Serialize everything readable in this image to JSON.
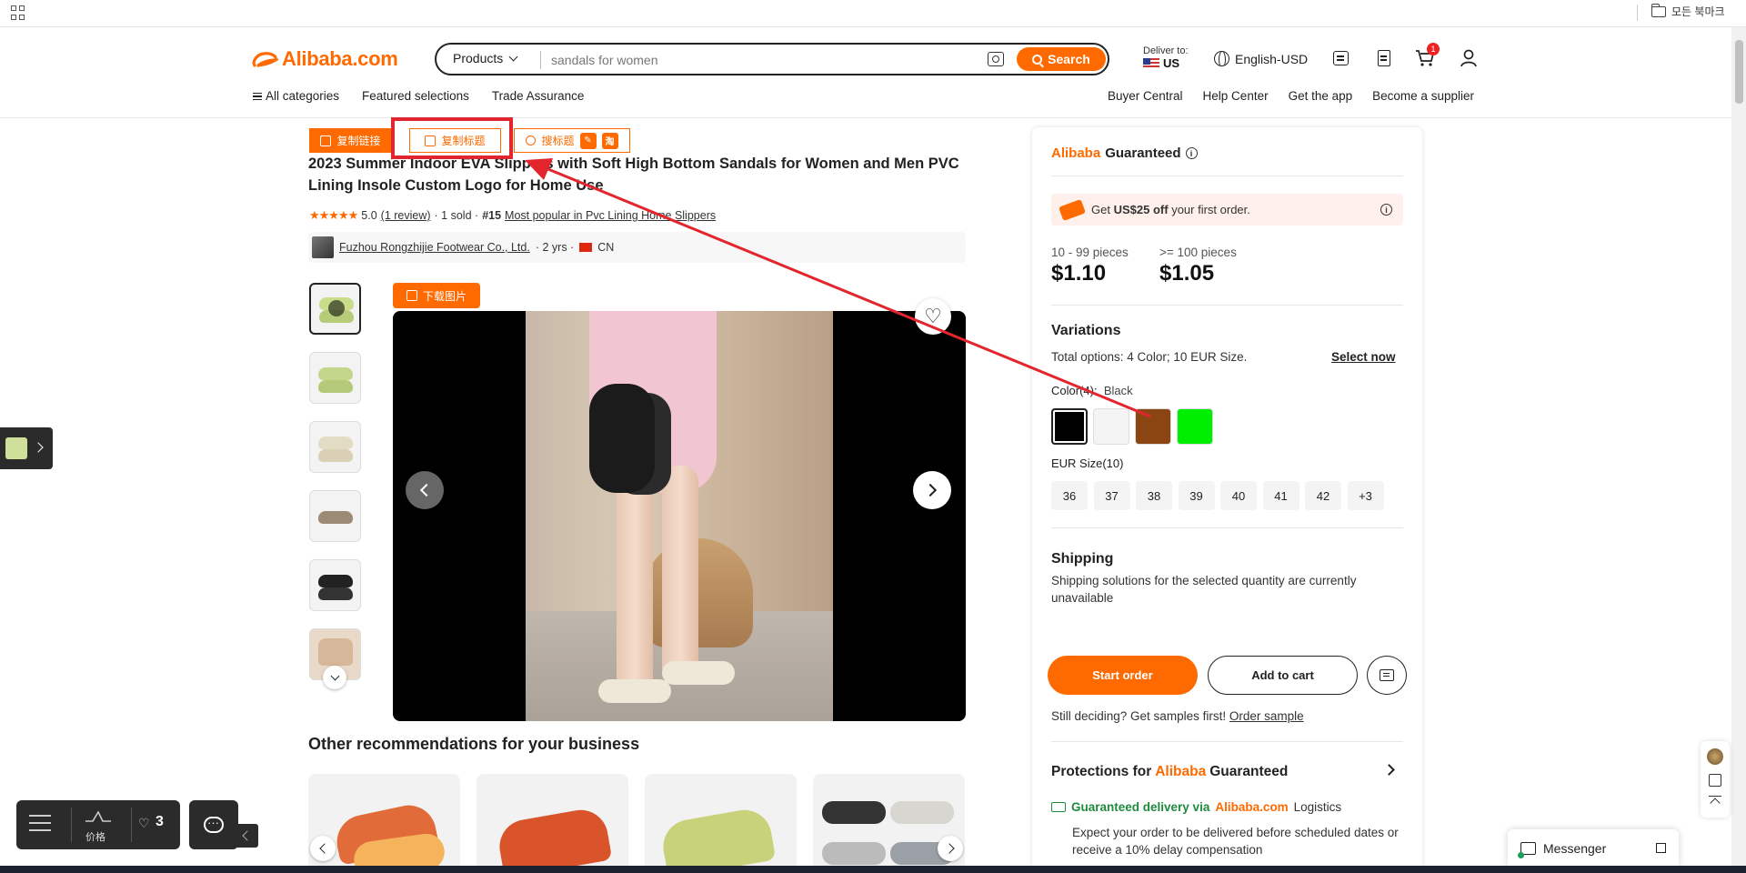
{
  "bookmark_bar": {
    "all_bookmarks": "모든 북마크"
  },
  "header": {
    "logo": "Alibaba.com",
    "search_category": "Products",
    "search_value": "sandals for women",
    "search_button": "Search",
    "deliver_label": "Deliver to:",
    "deliver_country": "US",
    "language": "English-USD",
    "cart_count": "1"
  },
  "nav": {
    "left": [
      "All categories",
      "Featured selections",
      "Trade Assurance"
    ],
    "right": [
      "Buyer Central",
      "Help Center",
      "Get the app",
      "Become a supplier"
    ]
  },
  "toolbar": {
    "copy_link": "复制链接",
    "copy_title": "复制标题",
    "search_title": "搜标题",
    "search_title_badge": "淘"
  },
  "product": {
    "title": "2023 Summer Indoor EVA Slippers with Soft High Bottom Sandals for Women and Men PVC Lining Insole Custom Logo for Home Use",
    "stars": "★★★★★",
    "rating": "5.0",
    "reviews": "(1 review)",
    "sold": "· 1 sold ·",
    "rank": "#15",
    "rank_text": "Most popular in Pvc Lining Home Slippers",
    "supplier": "Fuzhou Rongzhijie Footwear Co., Ltd.",
    "years": "· 2 yrs ·",
    "country": "CN",
    "download_image": "下载图片"
  },
  "recommendations": {
    "title": "Other recommendations for your business"
  },
  "panel": {
    "guaranteed_brand": "Alibaba",
    "guaranteed_word": "Guaranteed",
    "coupon_pre": "Get",
    "coupon_amount": "US$25 off",
    "coupon_post": "your first order.",
    "prices": [
      {
        "qty": "10 - 99 pieces",
        "price": "$1.10"
      },
      {
        "qty": ">= 100 pieces",
        "price": "$1.05"
      }
    ],
    "variations_title": "Variations",
    "variations_sub": "Total options: 4 Color; 10 EUR Size.",
    "select_now": "Select now",
    "color_label": "Color(4):",
    "color_selected": "Black",
    "colors": [
      "#000000",
      "#f4f4f4",
      "#8b4513",
      "#00ee00"
    ],
    "size_label": "EUR Size(10)",
    "sizes": [
      "36",
      "37",
      "38",
      "39",
      "40",
      "41",
      "42",
      "+3"
    ],
    "shipping_title": "Shipping",
    "shipping_text": "Shipping solutions for the selected quantity are currently unavailable",
    "start_order": "Start order",
    "add_to_cart": "Add to cart",
    "samples_text": "Still deciding? Get samples first!",
    "order_sample": "Order sample",
    "protections_pre": "Protections for",
    "protections_brand": "Alibaba",
    "protections_word": "Guaranteed",
    "gd_pre": "Guaranteed delivery via",
    "gd_brand": "Alibaba.com",
    "gd_post": "Logistics",
    "gd_text": "Expect your order to be delivered before scheduled dates or receive a 10% delay compensation"
  },
  "floating": {
    "price_label": "价格",
    "fav_count": "3",
    "messenger": "Messenger"
  },
  "colors": {
    "accent": "#ff6a00",
    "annotation": "#e3262d"
  }
}
